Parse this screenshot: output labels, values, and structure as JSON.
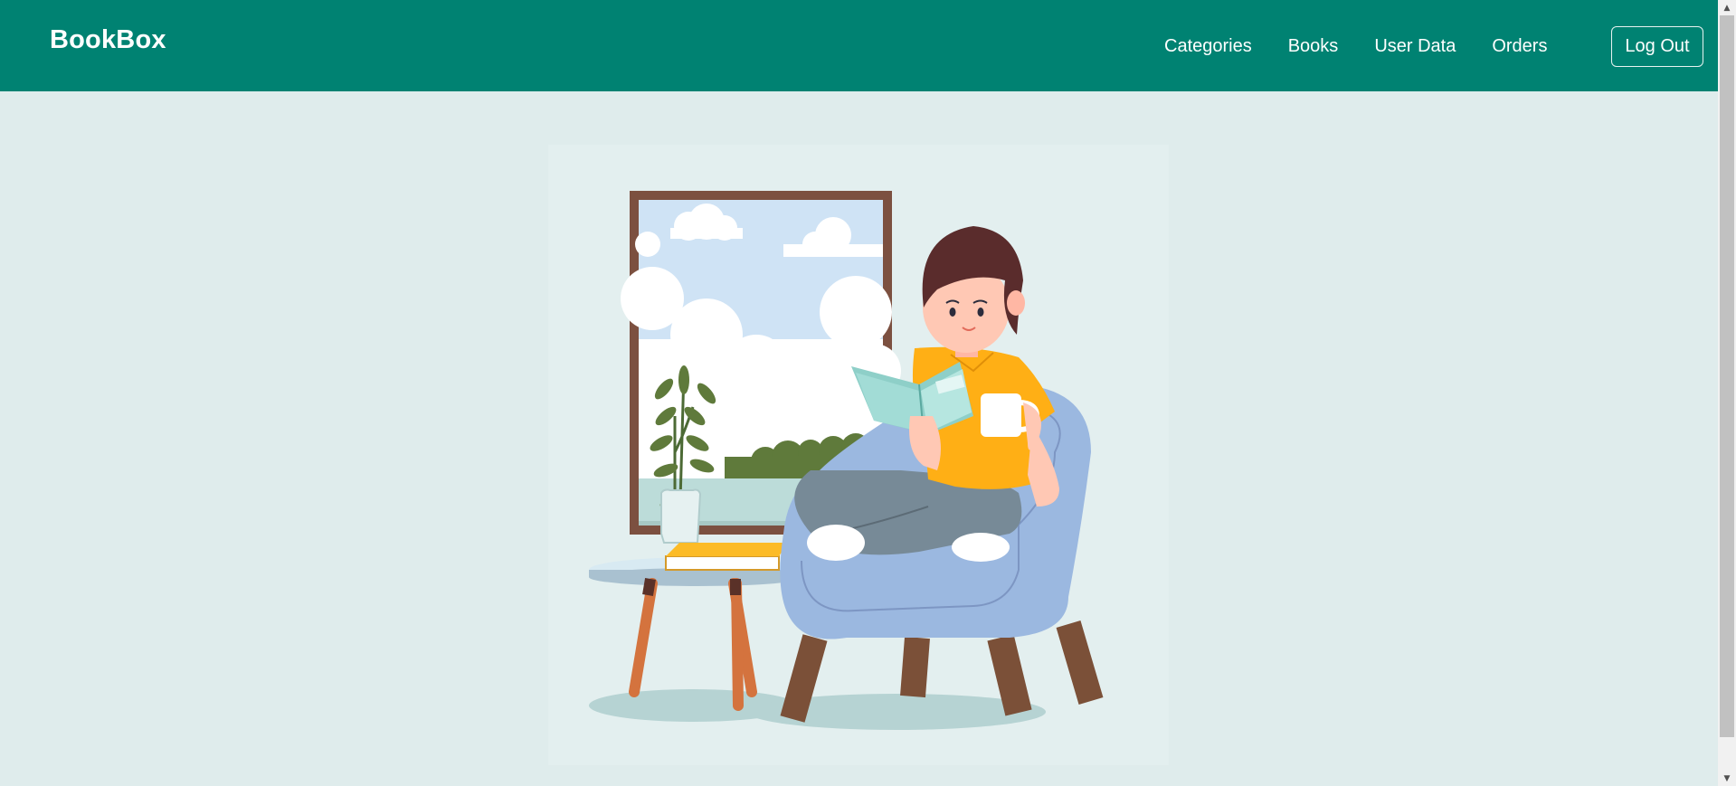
{
  "navbar": {
    "brand": "BookBox",
    "links": [
      "Categories",
      "Books",
      "User Data",
      "Orders"
    ],
    "logout_label": "Log Out"
  },
  "hero": {
    "illustration": "person-reading-in-armchair"
  },
  "colors": {
    "navbar_bg": "#008272",
    "page_bg": "#dfecec"
  }
}
